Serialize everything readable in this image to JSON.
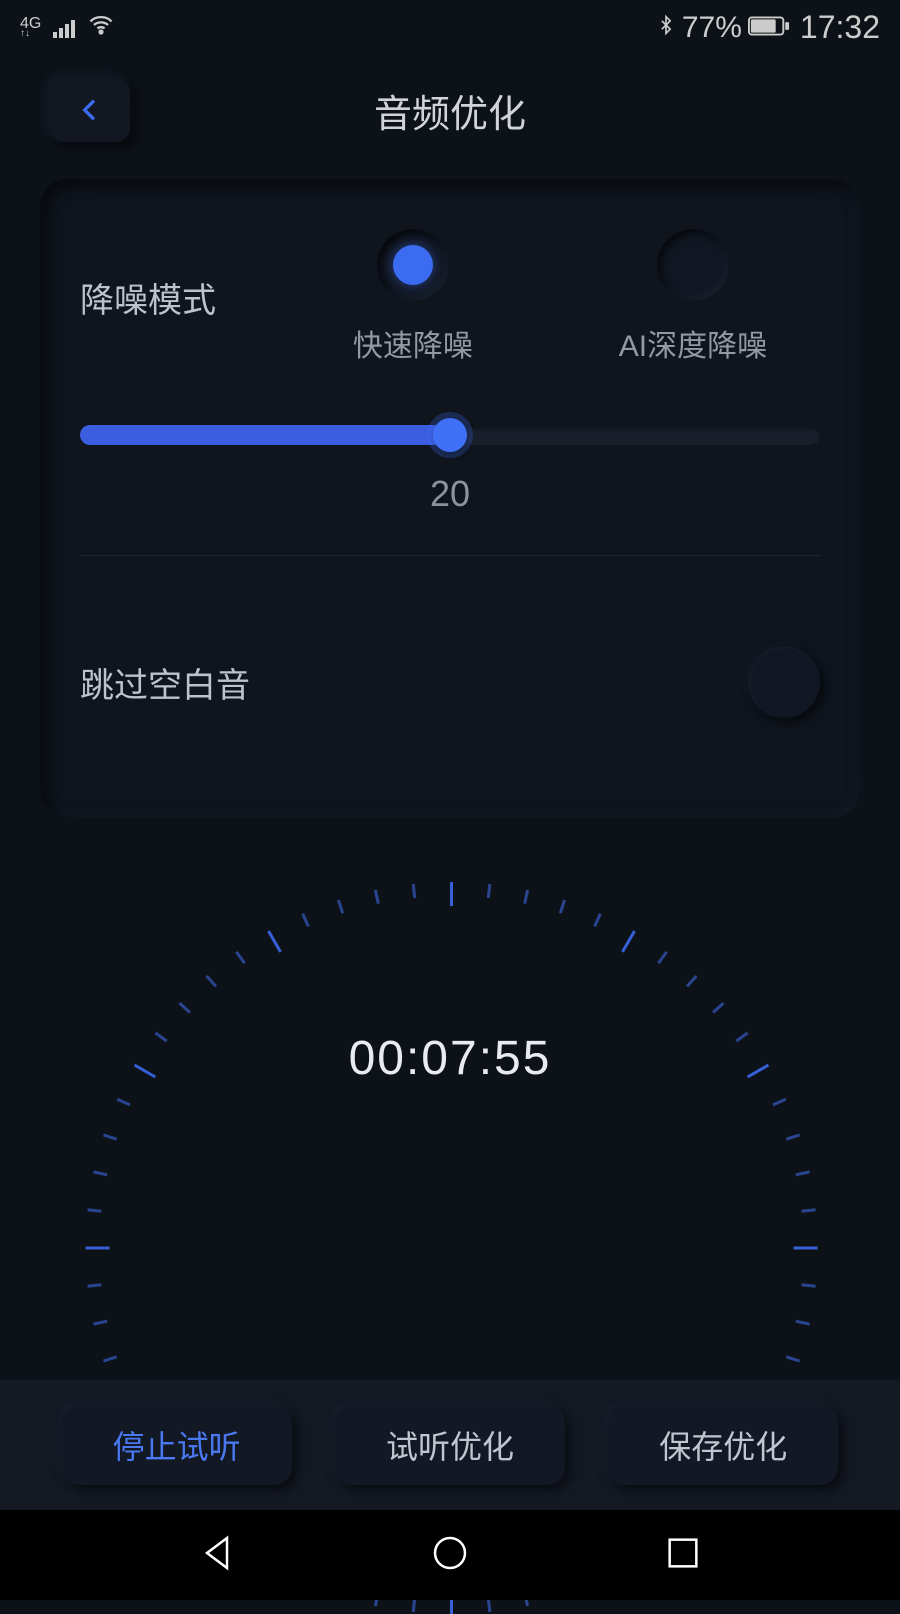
{
  "statusBar": {
    "network": "4G",
    "batteryPct": "77%",
    "time": "17:32"
  },
  "header": {
    "title": "音频优化"
  },
  "noiseReduction": {
    "label": "降噪模式",
    "options": [
      {
        "label": "快速降噪",
        "selected": true
      },
      {
        "label": "AI深度降噪",
        "selected": false
      }
    ],
    "sliderValue": "20",
    "sliderPercent": 50
  },
  "skipSilence": {
    "label": "跳过空白音",
    "enabled": false
  },
  "timer": {
    "display": "00:07:55"
  },
  "buttons": {
    "stop": "停止试听",
    "preview": "试听优化",
    "save": "保存优化"
  }
}
